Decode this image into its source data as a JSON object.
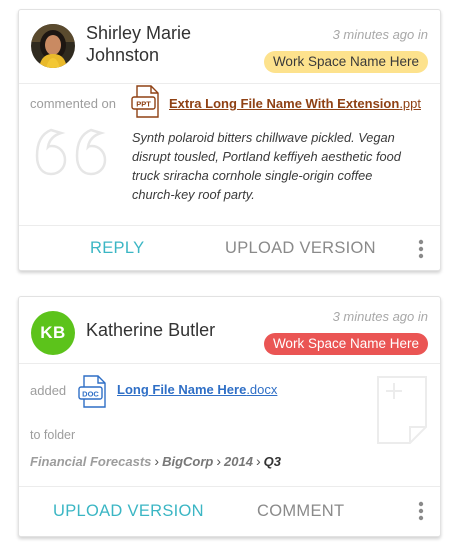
{
  "cards": [
    {
      "user": {
        "first_name": "Shirley Marie",
        "last_name": "Johnston"
      },
      "time": "3 minutes ago in",
      "workspace": "Work Space Name Here",
      "activity": "commented on",
      "file": {
        "type_badge": "PPT",
        "name": "Extra Long File Name With Extension",
        "ext": ".ppt"
      },
      "comment": "Synth polaroid bitters chillwave pickled. Vegan disrupt tousled, Portland keffiyeh aesthetic food truck sriracha cornhole single-origin coffee church-key roof party.",
      "actions": {
        "primary": "REPLY",
        "secondary": "UPLOAD VERSION"
      }
    },
    {
      "user": {
        "initials": "KB",
        "first_name": "Katherine",
        "last_name": "Butler"
      },
      "time": "3 minutes ago in",
      "workspace": "Work Space Name Here",
      "activity": "added",
      "file": {
        "type_badge": "DOC",
        "name": "Long File Name Here",
        "ext": ".docx"
      },
      "folder_label": "to folder",
      "folder_path": [
        "Financial Forecasts",
        "BigCorp",
        "2014",
        "Q3"
      ],
      "actions": {
        "primary": "UPLOAD VERSION",
        "secondary": "COMMENT"
      }
    }
  ],
  "colors": {
    "accent_teal": "#3bb6c4",
    "badge_yellow": "#fde28d",
    "badge_red": "#ea5554",
    "ppt_brown": "#8f4114",
    "doc_blue": "#2f6fc6",
    "avatar_green": "#5cc31b"
  },
  "icons": {
    "ppt_file": "ppt-file-icon",
    "doc_file": "doc-file-icon",
    "quote": "quote-icon",
    "new_doc": "new-document-icon",
    "more": "more-vertical-icon"
  }
}
